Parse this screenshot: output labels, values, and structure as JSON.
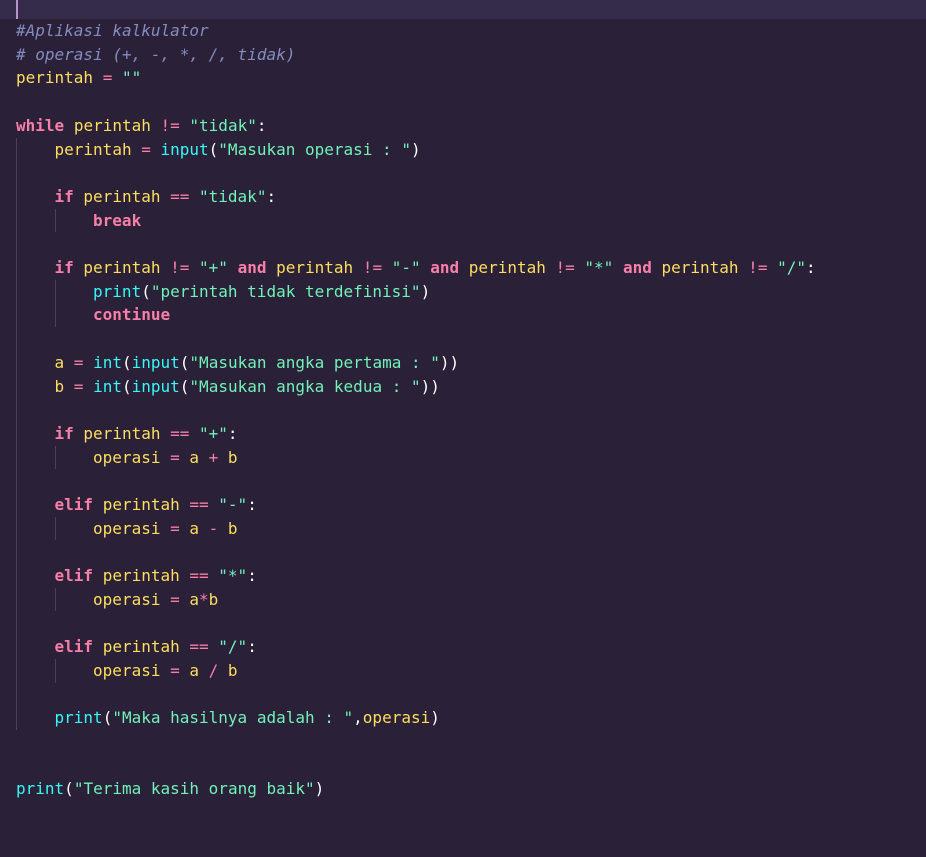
{
  "theme": {
    "background": "#2a2139",
    "current_line": "#352b4a",
    "comment": "#848bbd",
    "keyword": "#f97ea8",
    "identifier": "#fede5d",
    "string": "#72f1b8",
    "function": "#36f9f6",
    "operator": "#fe4450",
    "plain": "#ffffff"
  },
  "code": {
    "lines": [
      {
        "indent": 0,
        "tokens": [
          {
            "t": "comment",
            "v": "#Aplikasi kalkulator"
          }
        ]
      },
      {
        "indent": 0,
        "tokens": [
          {
            "t": "comment",
            "v": "# operasi (+, -, *, /, tidak)"
          }
        ]
      },
      {
        "indent": 0,
        "tokens": [
          {
            "t": "ident",
            "v": "perintah"
          },
          {
            "t": "op",
            "v": " = "
          },
          {
            "t": "str",
            "v": "\"\""
          }
        ]
      },
      {
        "indent": 0,
        "tokens": []
      },
      {
        "indent": 0,
        "tokens": [
          {
            "t": "kw",
            "v": "while"
          },
          {
            "t": "plain",
            "v": " "
          },
          {
            "t": "ident",
            "v": "perintah"
          },
          {
            "t": "op",
            "v": " != "
          },
          {
            "t": "str",
            "v": "\"tidak\""
          },
          {
            "t": "plain",
            "v": ":"
          }
        ]
      },
      {
        "indent": 1,
        "tokens": [
          {
            "t": "ident",
            "v": "perintah"
          },
          {
            "t": "op",
            "v": " = "
          },
          {
            "t": "fn",
            "v": "input"
          },
          {
            "t": "plain",
            "v": "("
          },
          {
            "t": "str",
            "v": "\"Masukan operasi : \""
          },
          {
            "t": "plain",
            "v": ")"
          }
        ]
      },
      {
        "indent": 1,
        "tokens": []
      },
      {
        "indent": 1,
        "tokens": [
          {
            "t": "kw",
            "v": "if"
          },
          {
            "t": "plain",
            "v": " "
          },
          {
            "t": "ident",
            "v": "perintah"
          },
          {
            "t": "op",
            "v": " == "
          },
          {
            "t": "str",
            "v": "\"tidak\""
          },
          {
            "t": "plain",
            "v": ":"
          }
        ]
      },
      {
        "indent": 2,
        "tokens": [
          {
            "t": "kw",
            "v": "break"
          }
        ]
      },
      {
        "indent": 1,
        "tokens": []
      },
      {
        "indent": 1,
        "tokens": [
          {
            "t": "kw",
            "v": "if"
          },
          {
            "t": "plain",
            "v": " "
          },
          {
            "t": "ident",
            "v": "perintah"
          },
          {
            "t": "op",
            "v": " != "
          },
          {
            "t": "str",
            "v": "\"+\""
          },
          {
            "t": "plain",
            "v": " "
          },
          {
            "t": "kw",
            "v": "and"
          },
          {
            "t": "plain",
            "v": " "
          },
          {
            "t": "ident",
            "v": "perintah"
          },
          {
            "t": "op",
            "v": " != "
          },
          {
            "t": "str",
            "v": "\"-\""
          },
          {
            "t": "plain",
            "v": " "
          },
          {
            "t": "kw",
            "v": "and"
          },
          {
            "t": "plain",
            "v": " "
          },
          {
            "t": "ident",
            "v": "perintah"
          },
          {
            "t": "op",
            "v": " != "
          },
          {
            "t": "str",
            "v": "\"*\""
          },
          {
            "t": "plain",
            "v": " "
          },
          {
            "t": "kw",
            "v": "and"
          },
          {
            "t": "plain",
            "v": " "
          },
          {
            "t": "ident",
            "v": "perintah"
          },
          {
            "t": "op",
            "v": " != "
          },
          {
            "t": "str",
            "v": "\"/\""
          },
          {
            "t": "plain",
            "v": ":"
          }
        ]
      },
      {
        "indent": 2,
        "tokens": [
          {
            "t": "fn",
            "v": "print"
          },
          {
            "t": "plain",
            "v": "("
          },
          {
            "t": "str",
            "v": "\"perintah tidak terdefinisi\""
          },
          {
            "t": "plain",
            "v": ")"
          }
        ]
      },
      {
        "indent": 2,
        "tokens": [
          {
            "t": "kw",
            "v": "continue"
          }
        ]
      },
      {
        "indent": 1,
        "tokens": []
      },
      {
        "indent": 1,
        "tokens": [
          {
            "t": "ident",
            "v": "a"
          },
          {
            "t": "op",
            "v": " = "
          },
          {
            "t": "fn",
            "v": "int"
          },
          {
            "t": "plain",
            "v": "("
          },
          {
            "t": "fn",
            "v": "input"
          },
          {
            "t": "plain",
            "v": "("
          },
          {
            "t": "str",
            "v": "\"Masukan angka pertama : \""
          },
          {
            "t": "plain",
            "v": "))"
          }
        ]
      },
      {
        "indent": 1,
        "tokens": [
          {
            "t": "ident",
            "v": "b"
          },
          {
            "t": "op",
            "v": " = "
          },
          {
            "t": "fn",
            "v": "int"
          },
          {
            "t": "plain",
            "v": "("
          },
          {
            "t": "fn",
            "v": "input"
          },
          {
            "t": "plain",
            "v": "("
          },
          {
            "t": "str",
            "v": "\"Masukan angka kedua : \""
          },
          {
            "t": "plain",
            "v": "))"
          }
        ]
      },
      {
        "indent": 1,
        "tokens": []
      },
      {
        "indent": 1,
        "tokens": [
          {
            "t": "kw",
            "v": "if"
          },
          {
            "t": "plain",
            "v": " "
          },
          {
            "t": "ident",
            "v": "perintah"
          },
          {
            "t": "op",
            "v": " == "
          },
          {
            "t": "str",
            "v": "\"+\""
          },
          {
            "t": "plain",
            "v": ":"
          }
        ]
      },
      {
        "indent": 2,
        "tokens": [
          {
            "t": "ident",
            "v": "operasi"
          },
          {
            "t": "op",
            "v": " = "
          },
          {
            "t": "ident",
            "v": "a"
          },
          {
            "t": "op",
            "v": " + "
          },
          {
            "t": "ident",
            "v": "b"
          }
        ]
      },
      {
        "indent": 1,
        "tokens": []
      },
      {
        "indent": 1,
        "tokens": [
          {
            "t": "kw",
            "v": "elif"
          },
          {
            "t": "plain",
            "v": " "
          },
          {
            "t": "ident",
            "v": "perintah"
          },
          {
            "t": "op",
            "v": " == "
          },
          {
            "t": "str",
            "v": "\"-\""
          },
          {
            "t": "plain",
            "v": ":"
          }
        ]
      },
      {
        "indent": 2,
        "tokens": [
          {
            "t": "ident",
            "v": "operasi"
          },
          {
            "t": "op",
            "v": " = "
          },
          {
            "t": "ident",
            "v": "a"
          },
          {
            "t": "op",
            "v": " - "
          },
          {
            "t": "ident",
            "v": "b"
          }
        ]
      },
      {
        "indent": 1,
        "tokens": []
      },
      {
        "indent": 1,
        "tokens": [
          {
            "t": "kw",
            "v": "elif"
          },
          {
            "t": "plain",
            "v": " "
          },
          {
            "t": "ident",
            "v": "perintah"
          },
          {
            "t": "op",
            "v": " == "
          },
          {
            "t": "str",
            "v": "\"*\""
          },
          {
            "t": "plain",
            "v": ":"
          }
        ]
      },
      {
        "indent": 2,
        "tokens": [
          {
            "t": "ident",
            "v": "operasi"
          },
          {
            "t": "op",
            "v": " = "
          },
          {
            "t": "ident",
            "v": "a"
          },
          {
            "t": "op",
            "v": "*"
          },
          {
            "t": "ident",
            "v": "b"
          }
        ]
      },
      {
        "indent": 1,
        "tokens": []
      },
      {
        "indent": 1,
        "tokens": [
          {
            "t": "kw",
            "v": "elif"
          },
          {
            "t": "plain",
            "v": " "
          },
          {
            "t": "ident",
            "v": "perintah"
          },
          {
            "t": "op",
            "v": " == "
          },
          {
            "t": "str",
            "v": "\"/\""
          },
          {
            "t": "plain",
            "v": ":"
          }
        ]
      },
      {
        "indent": 2,
        "tokens": [
          {
            "t": "ident",
            "v": "operasi"
          },
          {
            "t": "op",
            "v": " = "
          },
          {
            "t": "ident",
            "v": "a"
          },
          {
            "t": "op",
            "v": " / "
          },
          {
            "t": "ident",
            "v": "b"
          }
        ]
      },
      {
        "indent": 1,
        "tokens": []
      },
      {
        "indent": 1,
        "tokens": [
          {
            "t": "fn",
            "v": "print"
          },
          {
            "t": "plain",
            "v": "("
          },
          {
            "t": "str",
            "v": "\"Maka hasilnya adalah : \""
          },
          {
            "t": "plain",
            "v": ","
          },
          {
            "t": "ident",
            "v": "operasi"
          },
          {
            "t": "plain",
            "v": ")"
          }
        ]
      },
      {
        "indent": 0,
        "tokens": []
      },
      {
        "indent": 0,
        "tokens": []
      },
      {
        "indent": 0,
        "tokens": [
          {
            "t": "fn",
            "v": "print"
          },
          {
            "t": "plain",
            "v": "("
          },
          {
            "t": "str",
            "v": "\"Terima kasih orang baik\""
          },
          {
            "t": "plain",
            "v": ")"
          }
        ]
      }
    ]
  }
}
